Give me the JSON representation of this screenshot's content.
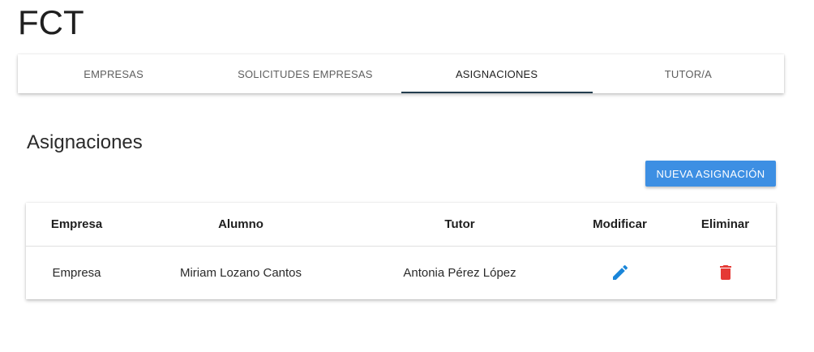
{
  "app": {
    "title": "FCT"
  },
  "tabs": [
    {
      "label": "EMPRESAS",
      "active": false
    },
    {
      "label": "SOLICITUDES EMPRESAS",
      "active": false
    },
    {
      "label": "ASIGNACIONES",
      "active": true
    },
    {
      "label": "TUTOR/A",
      "active": false
    }
  ],
  "section": {
    "title": "Asignaciones",
    "new_button_label": "NUEVA ASIGNACIÓN"
  },
  "table": {
    "headers": [
      "Empresa",
      "Alumno",
      "Tutor",
      "Modificar",
      "Eliminar"
    ],
    "rows": [
      {
        "empresa": "Empresa",
        "alumno": "Miriam Lozano Cantos",
        "tutor": "Antonia Pérez López",
        "edit_icon": "pencil-icon",
        "delete_icon": "trash-icon"
      }
    ]
  },
  "colors": {
    "tab_indicator": "#243e4f",
    "primary_button": "#3d8fe3",
    "edit_icon": "#1a86d9",
    "delete_icon": "#e53935"
  }
}
